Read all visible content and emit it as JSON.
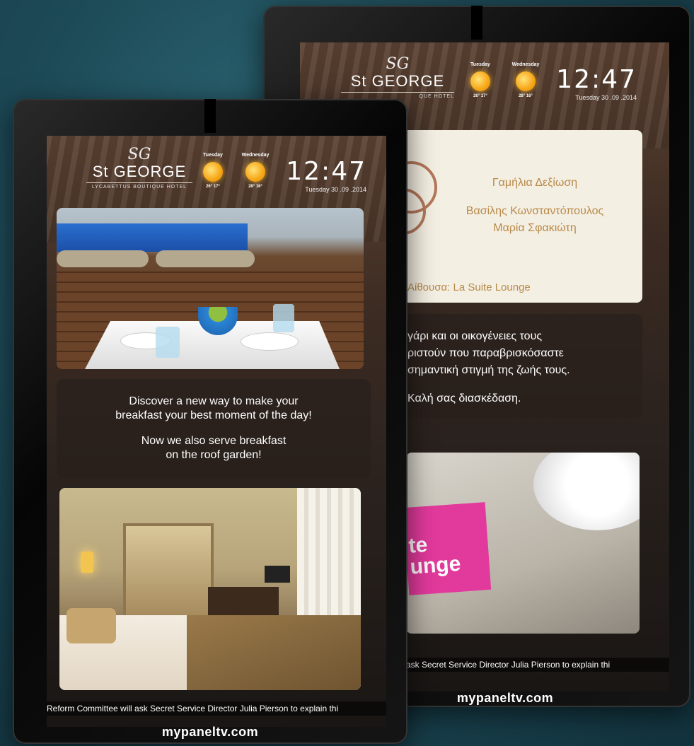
{
  "hotel": {
    "name": "St GEORGE",
    "monogram": "SG",
    "subtitle_front": "LYCABETTUS BOUTIQUE HOTEL",
    "subtitle_back": "QUE HOTEL"
  },
  "weather": [
    {
      "day": "Tuesday",
      "temps": "26° 17°",
      "icon": "sun-icon"
    },
    {
      "day": "Wednesday",
      "temps": "28° 16°",
      "icon": "sun-icon"
    }
  ],
  "clock": {
    "time": "12:47",
    "date": "Tuesday 30 .09 .2014"
  },
  "front_screen": {
    "promo_line1": "Discover a new way to make your",
    "promo_line2": "breakfast your best moment of the day!",
    "promo_line3": "Now we also serve breakfast",
    "promo_line4": "on the roof garden!",
    "ticker": "Reform Committee will ask Secret Service Director Julia Pierson to explain thi",
    "breakfast_photo": "breakfast-table-photo",
    "room_photo": "hotel-room-photo"
  },
  "back_screen": {
    "event_title": "Γαμήλια Δεξίωση",
    "groom": "Βασίλης Κωνσταντόπουλος",
    "bride": "Μαρία Σφακιώτη",
    "hall": "Αίθουσα: La Suite Lounge",
    "message_line1": "γάρι και οι οικογένειες τους",
    "message_line2": "ριστούν που παραβρισκόσαστε",
    "message_line3": "σημαντική στιγμή της ζωής τους.",
    "message_line4": "Καλή σας διασκέδαση.",
    "menu_sign_line1": "te",
    "menu_sign_line2": "unge",
    "ticker": "ask Secret Service Director Julia Pierson to explain thi"
  },
  "brand": "mypaneltv.com",
  "colors": {
    "accent_gold": "#b88a4a",
    "sign_pink": "#e23a9c"
  }
}
